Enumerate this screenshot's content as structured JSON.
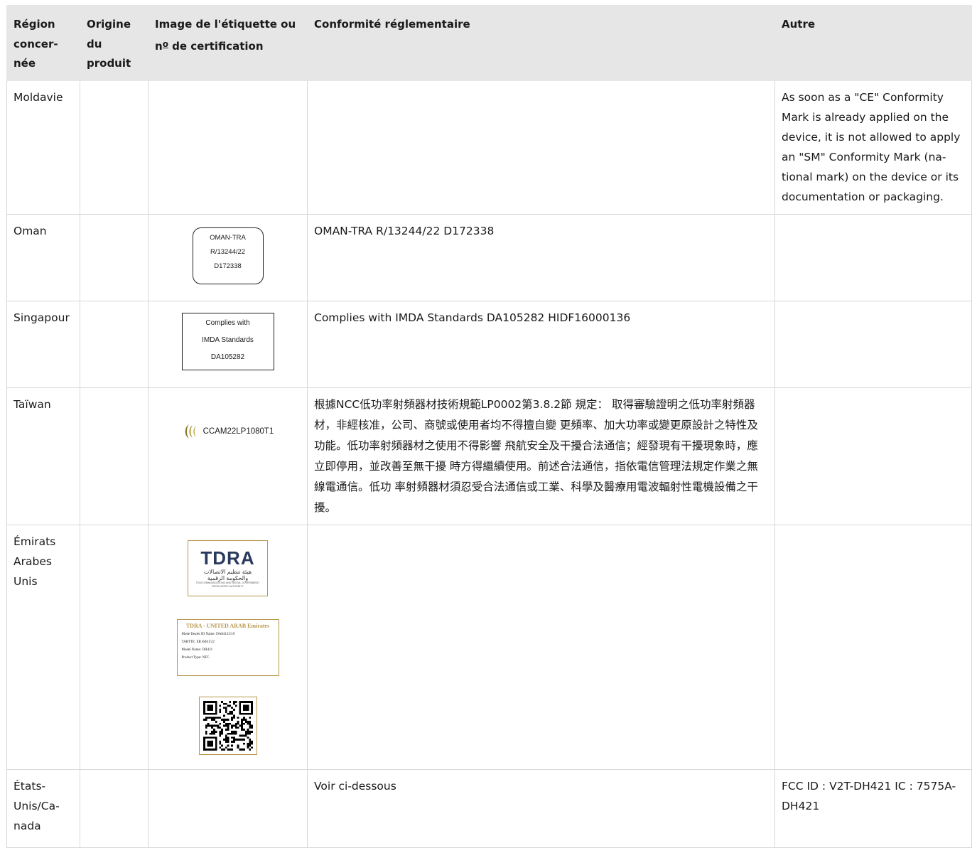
{
  "header": {
    "region": "Région concer-née",
    "origin": "Origine du produit",
    "image_main": "Image de l'étiquette ou n",
    "image_sup": "o",
    "image_tail": " de certification",
    "conformity": "Conformité réglementaire",
    "other": "Autre"
  },
  "rows": {
    "moldova": {
      "region": "Moldavie",
      "other": "As soon as a \"CE\" Conformity Mark is already applied on the device, it is not allowed to apply an \"SM\" Conformity Mark (na-tional mark) on the device or its documentation or packaging."
    },
    "oman": {
      "region": "Oman",
      "label_line1": "OMAN-TRA",
      "label_line2": "R/13244/22",
      "label_line3": "D172338",
      "conformity": "OMAN-TRA R/13244/22 D172338"
    },
    "singapore": {
      "region": "Singapour",
      "label_line1": "Complies with",
      "label_line2": "IMDA Standards",
      "label_line3": "DA105282",
      "conformity": "Complies with IMDA Standards DA105282 HIDF16000136"
    },
    "taiwan": {
      "region": "Taïwan",
      "label": "CCAM22LP1080T1",
      "conformity": "根據NCC低功率射頻器材技術規範LP0002第3.8.2節 規定： 取得審驗證明之低功率射頻器材，非經核准，公司、商號或使用者均不得擅自變 更頻率、加大功率或變更原設計之特性及功能。低功率射頻器材之使用不得影響 飛航安全及干擾合法通信；經發現有干擾現象時，應立即停用，並改善至無干擾 時方得繼續使用。前述合法通信，指依電信管理法規定作業之無線電通信。低功 率射頻器材須忍受合法通信或工業、科學及醫療用電波輻射性電機設備之干擾。"
    },
    "uae": {
      "region": "Émirats Arabes Unis",
      "logo_text": "TDRA",
      "logo_arabic_1": "هيئة تنظيم الاتصالات",
      "logo_arabic_2": "والحكومة الرقمية",
      "logo_english": "TELECOMMUNICATIONS AND DIGITAL GOVERNMENT REGULATORY AUTHORITY",
      "label_title": "TDRA - UNITED ARAB Emirates",
      "label_dealer": "Mode Dealer ID Name: DA84123/19",
      "label_tartte": "TARTTE: ER16461/22",
      "label_model": "Model Name: DH421",
      "label_type": "Product Type: NFC"
    },
    "usca": {
      "region": "États-Unis/Ca-nada",
      "conformity": "Voir ci-dessous",
      "other": "FCC ID : V2T-DH421 IC : 7575A-DH421"
    }
  }
}
